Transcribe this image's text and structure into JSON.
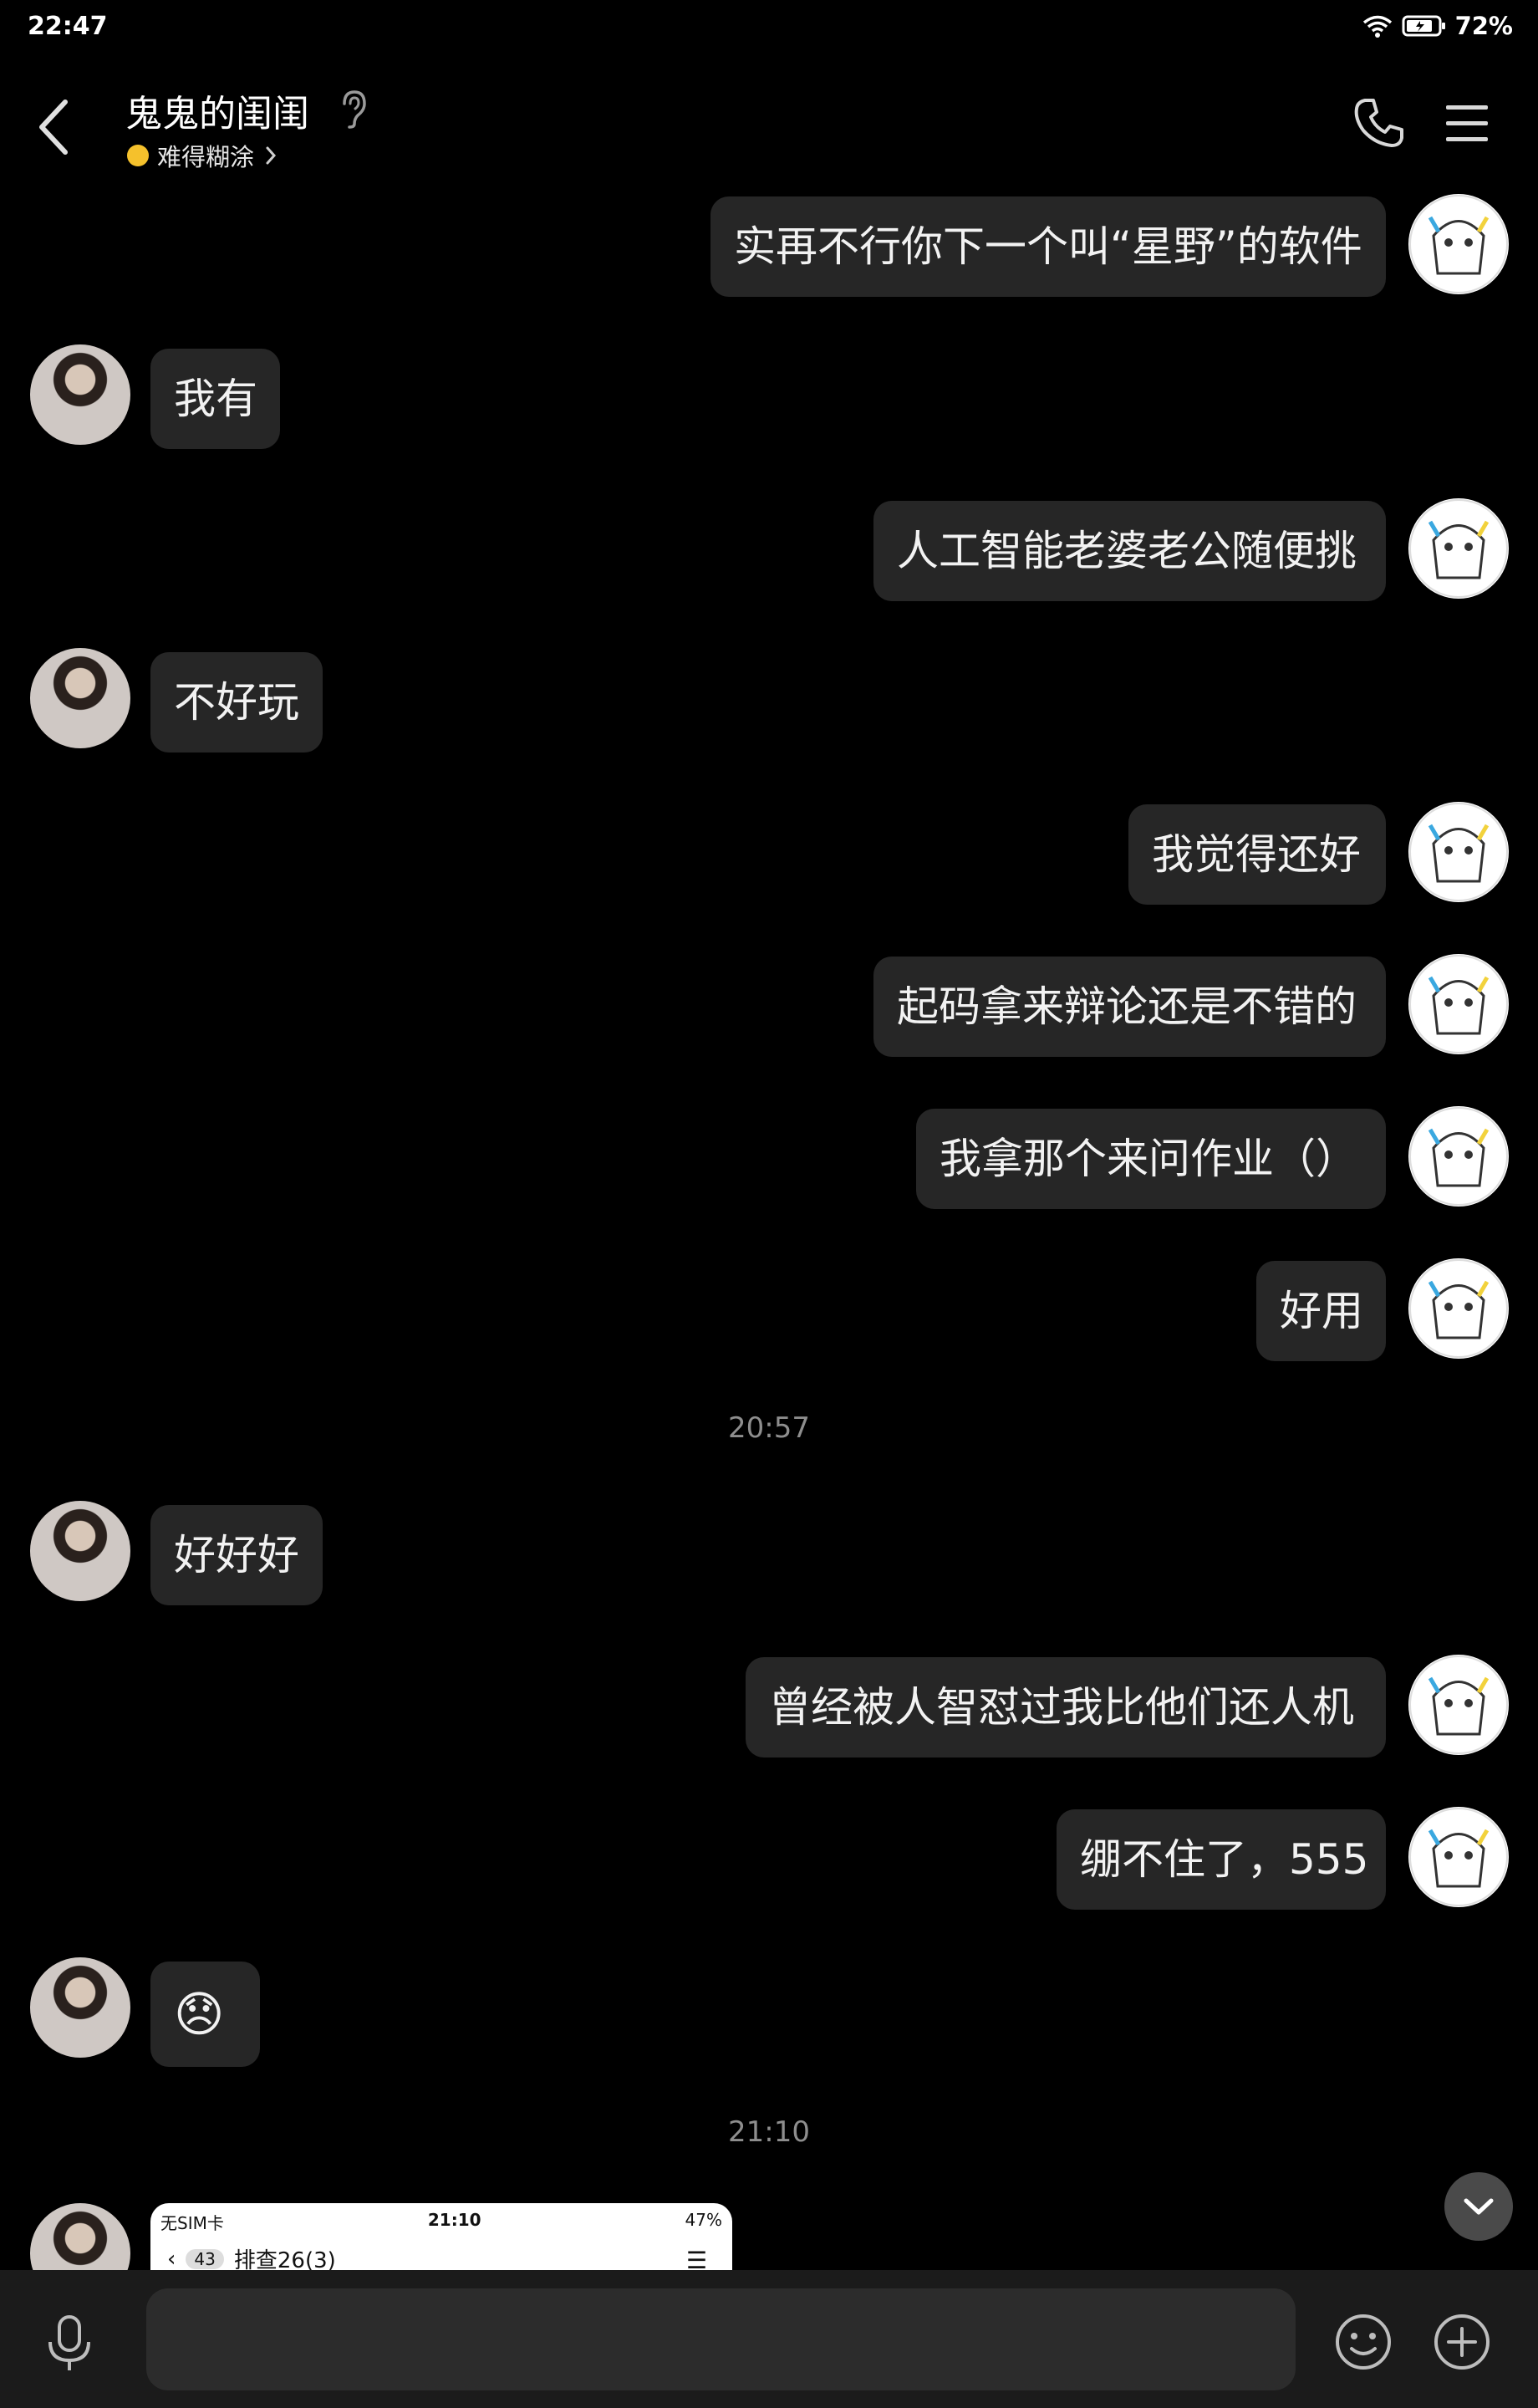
{
  "status": {
    "time": "22:47",
    "battery": "72%"
  },
  "header": {
    "title": "鬼鬼的闺闺",
    "subtitle": "难得糊涂"
  },
  "messages": [
    {
      "side": "right",
      "text": "实再不行你下一个叫“星野”的软件"
    },
    {
      "side": "left",
      "text": "我有"
    },
    {
      "side": "right",
      "text": "人工智能老婆老公随便挑"
    },
    {
      "side": "left",
      "text": "不好玩"
    },
    {
      "side": "right",
      "text": "我觉得还好"
    },
    {
      "side": "right",
      "text": "起码拿来辩论还是不错的"
    },
    {
      "side": "right",
      "text": "我拿那个来问作业（）"
    },
    {
      "side": "right",
      "text": "好用"
    },
    {
      "side": "center",
      "text": "20:57"
    },
    {
      "side": "left",
      "text": "好好好"
    },
    {
      "side": "right",
      "text": "曾经被人智怼过我比他们还人机"
    },
    {
      "side": "right",
      "text": "绷不住了，555"
    },
    {
      "side": "left",
      "text": "😞"
    },
    {
      "side": "center",
      "text": "21:10"
    }
  ],
  "screenshot": {
    "carrier": "无SIM卡",
    "time": "21:10",
    "battery": "47%",
    "back_count": "43",
    "title": "排查26(3)"
  },
  "icons": {
    "back": "chevron-left-icon",
    "ear": "ear-icon",
    "phone": "phone-icon",
    "menu": "hamburger-menu-icon",
    "mic": "microphone-icon",
    "emoji": "smiley-icon",
    "plus": "plus-circle-icon",
    "scroll": "chevron-down-icon"
  },
  "colors": {
    "background": "#000000",
    "bubble": "#262626",
    "bottom_bar": "#1b1b1b",
    "timestamp": "#8e8e8e"
  }
}
